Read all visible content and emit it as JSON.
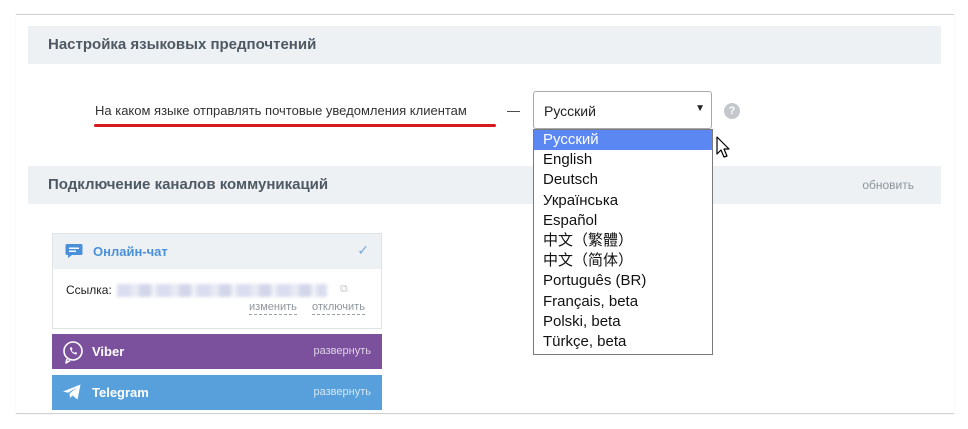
{
  "language_section": {
    "title": "Настройка языковых предпочтений",
    "question": "На каком языке отправлять почтовые уведомления клиентам",
    "dash": "—",
    "selected_language": "Русский",
    "select_arrow": "▼",
    "help": "?",
    "options": [
      "Русский",
      "English",
      "Deutsch",
      "Українська",
      "Español",
      "中文（繁體）",
      "中文（简体）",
      "Português (BR)",
      "Français, beta",
      "Polski, beta",
      "Türkçe, beta"
    ],
    "highlight_color": "#5b87f3",
    "underline_color": "#d6191e"
  },
  "channels_section": {
    "title": "Подключение каналов коммуникаций",
    "refresh": "обновить",
    "online_chat": {
      "name": "Онлайн-чат",
      "check": "✓",
      "link_label": "Ссылка:",
      "change": "изменить",
      "disable": "отключить",
      "icon": "chat-bubble-icon"
    },
    "viber": {
      "name": "Viber",
      "expand": "развернуть",
      "color": "#7b519d",
      "icon": "viber-icon"
    },
    "telegram": {
      "name": "Telegram",
      "expand": "развернуть",
      "color": "#57a0dc",
      "icon": "telegram-icon"
    }
  }
}
